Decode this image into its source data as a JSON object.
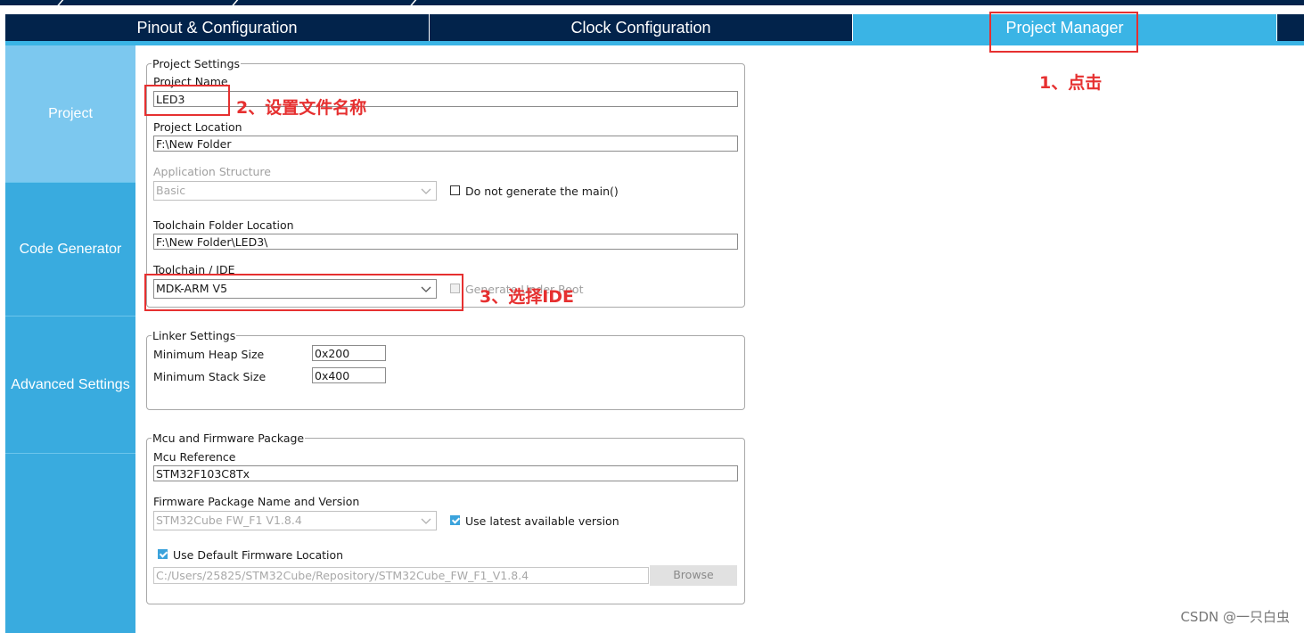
{
  "tabs": [
    {
      "label": "Pinout & Configuration",
      "active": false
    },
    {
      "label": "Clock Configuration",
      "active": false
    },
    {
      "label": "Project Manager",
      "active": true
    }
  ],
  "sidebar": {
    "items": [
      {
        "label": "Project",
        "active": true
      },
      {
        "label": "Code Generator",
        "active": false
      },
      {
        "label": "Advanced Settings",
        "active": false
      }
    ]
  },
  "project_settings": {
    "legend": "Project Settings",
    "project_name_label": "Project Name",
    "project_name_value": "LED3",
    "project_location_label": "Project Location",
    "project_location_value": "F:\\New Folder",
    "app_structure_label": "Application Structure",
    "app_structure_value": "Basic",
    "no_main_label": "Do not generate the main()",
    "toolchain_folder_label": "Toolchain Folder Location",
    "toolchain_folder_value": "F:\\New Folder\\LED3\\",
    "toolchain_ide_label": "Toolchain / IDE",
    "toolchain_ide_value": "MDK-ARM V5",
    "generate_root_label": "Generate Under Root"
  },
  "linker_settings": {
    "legend": "Linker Settings",
    "heap_label": "Minimum Heap Size",
    "heap_value": "0x200",
    "stack_label": "Minimum Stack Size",
    "stack_value": "0x400"
  },
  "mcu_firmware": {
    "legend": "Mcu and Firmware Package",
    "mcu_ref_label": "Mcu Reference",
    "mcu_ref_value": "STM32F103C8Tx",
    "fw_name_label": "Firmware Package Name and Version",
    "fw_name_value": "STM32Cube FW_F1 V1.8.4",
    "use_latest_label": "Use latest available version",
    "use_default_label": "Use Default Firmware Location",
    "fw_path_value": "C:/Users/25825/STM32Cube/Repository/STM32Cube_FW_F1_V1.8.4",
    "browse_label": "Browse"
  },
  "annotations": {
    "step1": "1、点击",
    "step2": "2、设置文件名称",
    "step3": "3、选择IDE"
  },
  "watermark": "CSDN @一只白虫",
  "colors": {
    "navy": "#02234b",
    "accent": "#3ab4e5",
    "sidebar": "#39abdf",
    "sidebar_active": "#7cc8ef",
    "annotation_red": "#e63030"
  }
}
